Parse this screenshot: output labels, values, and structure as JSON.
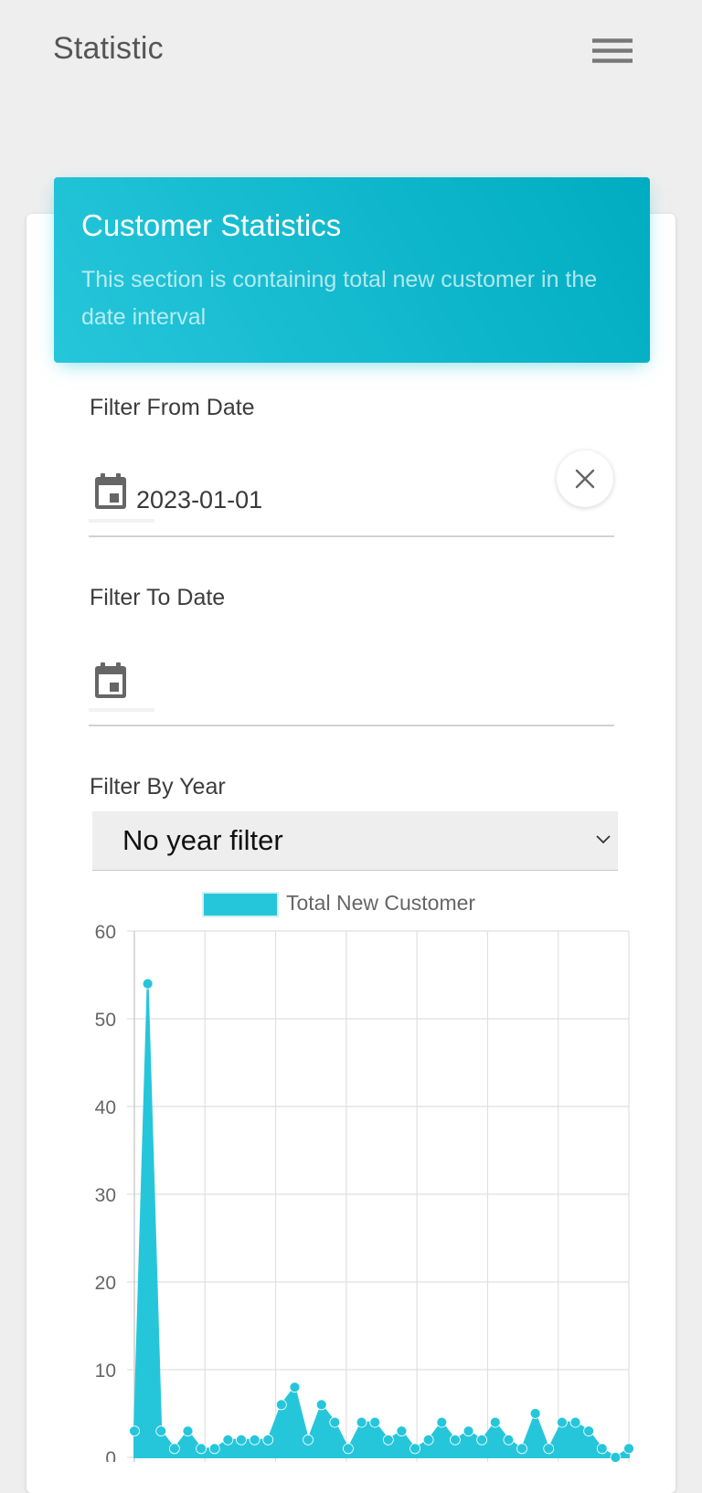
{
  "app": {
    "title": "Statistic"
  },
  "icons": {
    "menu": "hamburger-menu-icon",
    "date": "calendar-icon",
    "clear": "close-icon",
    "dropdown": "chevron-down-icon"
  },
  "colors": {
    "accent": "#00acc1",
    "accent_light": "#26c6da",
    "background": "#eeeeee"
  },
  "card": {
    "title": "Customer Statistics",
    "subtitle": "This section is containing total new customer in the date interval"
  },
  "filters": {
    "from_label": "Filter From Date",
    "from_value": "2023-01-01",
    "to_label": "Filter To Date",
    "to_value": "",
    "year_label": "Filter By Year",
    "year_selected": "No year filter"
  },
  "chart_data": {
    "type": "area",
    "legend": "Total New Customer",
    "legend_position": "top",
    "grid": true,
    "ylim": [
      0,
      60
    ],
    "yticks": [
      0,
      10,
      20,
      30,
      40,
      50,
      60
    ],
    "vertical_gridlines": 7,
    "series": [
      {
        "name": "Total New Customer",
        "color": "#26c6da",
        "values": [
          3,
          54,
          3,
          1,
          3,
          1,
          1,
          2,
          2,
          2,
          2,
          6,
          8,
          2,
          6,
          4,
          1,
          4,
          4,
          2,
          3,
          1,
          2,
          4,
          2,
          3,
          2,
          4,
          2,
          1,
          5,
          1,
          4,
          4,
          3,
          1,
          0,
          1
        ]
      }
    ]
  }
}
